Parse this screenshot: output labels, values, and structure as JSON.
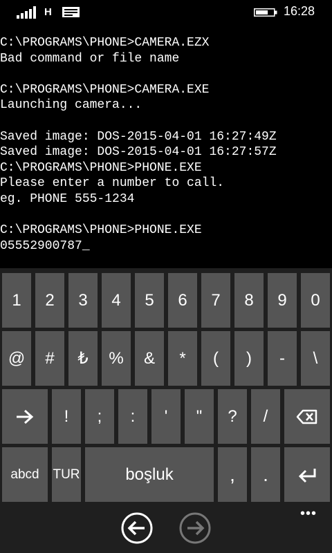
{
  "status_bar": {
    "network_type": "H",
    "time": "16:28",
    "signal_icon": "signal-bars-icon",
    "message_icon": "message-icon",
    "battery_icon": "battery-icon",
    "battery_level": 0.7
  },
  "console": {
    "lines": [
      "C:\\PROGRAMS\\PHONE>CAMERA.EZX",
      "Bad command or file name",
      "",
      "C:\\PROGRAMS\\PHONE>CAMERA.EXE",
      "Launching camera...",
      "",
      "Saved image: DOS-2015-04-01 16:27:49Z",
      "Saved image: DOS-2015-04-01 16:27:57Z",
      "C:\\PROGRAMS\\PHONE>PHONE.EXE",
      "Please enter a number to call.",
      "eg. PHONE 555-1234",
      "",
      "C:\\PROGRAMS\\PHONE>PHONE.EXE",
      "05552900787_"
    ]
  },
  "keyboard": {
    "row1": [
      "1",
      "2",
      "3",
      "4",
      "5",
      "6",
      "7",
      "8",
      "9",
      "0"
    ],
    "row2": [
      "@",
      "#",
      "₺",
      "%",
      "&",
      "*",
      "(",
      ")",
      "-",
      "\\"
    ],
    "row3": [
      "!",
      ";",
      ":",
      "'",
      "\"",
      "?",
      "/"
    ],
    "row3_icons": {
      "tab": "tab-arrow-icon",
      "backspace": "backspace-icon"
    },
    "row4": {
      "abc": "abcd",
      "lang": "TUR",
      "space": "boşluk",
      "comma": ",",
      "period": ".",
      "enter_icon": "enter-icon"
    }
  },
  "nav": {
    "back_icon": "back-arrow-icon",
    "forward_icon": "forward-arrow-icon",
    "more": "•••"
  },
  "colors": {
    "background": "#000000",
    "key": "#555555",
    "keyboard_bg": "#1f1f1f",
    "forward_disabled": "#777777"
  }
}
